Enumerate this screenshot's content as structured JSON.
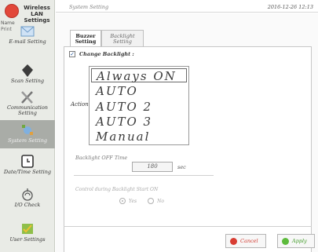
{
  "sidebar": {
    "title": "Wireless LAN Settings",
    "name_label": "Name",
    "name_value": "Print",
    "items": [
      {
        "label": "E-mail Setting",
        "icon": "email-icon"
      },
      {
        "label": "Scan Setting",
        "icon": "scanner-icon"
      },
      {
        "label": "Communication Setting",
        "icon": "tools-icon"
      },
      {
        "label": "System Setting",
        "icon": "system-icon"
      },
      {
        "label": "Date/Time Setting",
        "icon": "clock-icon"
      },
      {
        "label": "I/O Check",
        "icon": "io-check-icon"
      },
      {
        "label": "User Settings",
        "icon": "user-settings-icon"
      }
    ]
  },
  "header": {
    "breadcrumb": "System Setting",
    "clock": "2016-12-26 12:13"
  },
  "tabs": [
    {
      "label": "Buzzer Setting",
      "active": true
    },
    {
      "label": "Backlight Setting",
      "active": false
    }
  ],
  "backlight": {
    "checkbox_label": "Change Backlight :",
    "checkbox_mark": "✓",
    "checked": true,
    "action_label": "Action",
    "options": [
      "Always ON",
      "AUTO",
      "AUTO 2",
      "AUTO 3",
      "Manual"
    ],
    "selected_option": "Always ON",
    "off_time_label": "Backlight OFF Time",
    "off_time_value": "180",
    "off_time_unit": "sec",
    "control_label": "Control during Backlight Start ON",
    "radio_options": [
      "Yes",
      "No"
    ],
    "radio_selected": "Yes"
  },
  "buttons": {
    "cancel": "Cancel",
    "apply": "Apply"
  },
  "colors": {
    "cancel": "#d83d33",
    "apply": "#5dbb3c",
    "sidebar_active": "#a9aca7"
  }
}
